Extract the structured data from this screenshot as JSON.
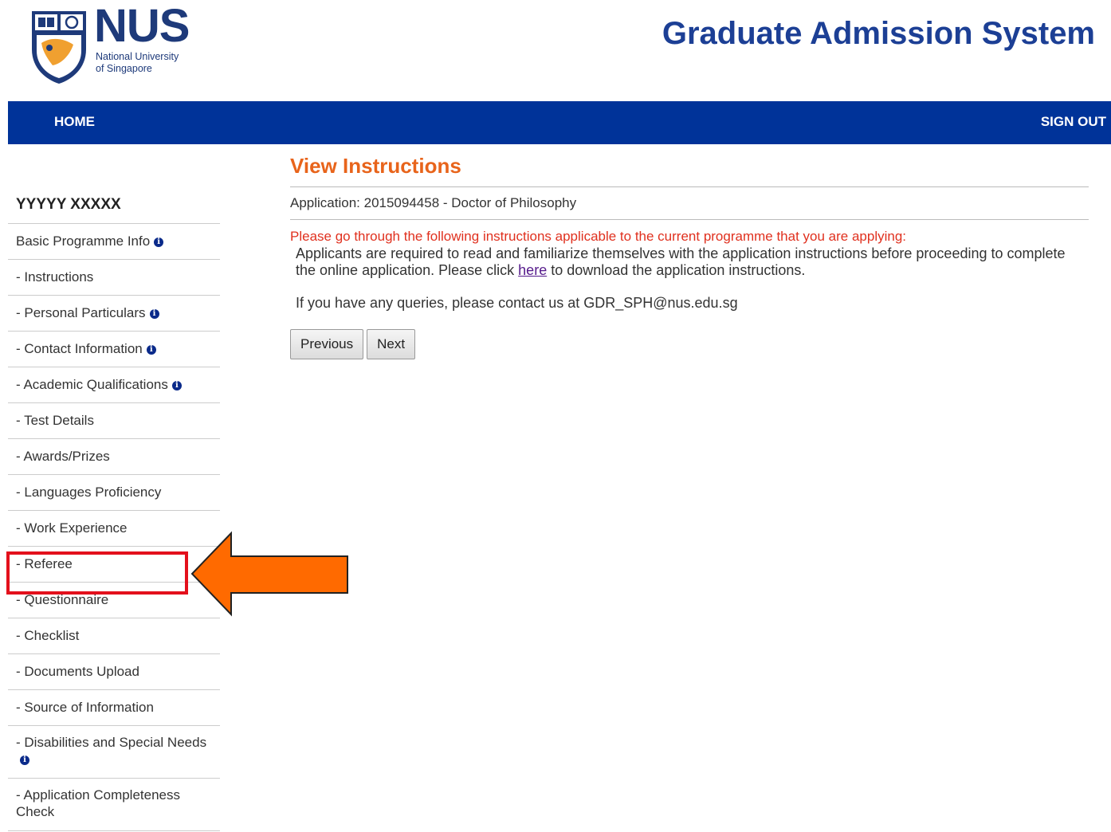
{
  "header": {
    "logo_text": "NUS",
    "logo_subtitle_line1": "National University",
    "logo_subtitle_line2": "of Singapore",
    "system_title": "Graduate Admission System"
  },
  "nav": {
    "home": "HOME",
    "sign_out": "SIGN OUT"
  },
  "sidebar": {
    "applicant_name": "YYYYY XXXXX",
    "items": [
      {
        "label": "Basic Programme Info",
        "info": true
      },
      {
        "label": "- Instructions",
        "info": false
      },
      {
        "label": "- Personal Particulars",
        "info": true
      },
      {
        "label": "- Contact Information",
        "info": true
      },
      {
        "label": "- Academic Qualifications",
        "info": true
      },
      {
        "label": "- Test Details",
        "info": false
      },
      {
        "label": "- Awards/Prizes",
        "info": false
      },
      {
        "label": "- Languages Proficiency",
        "info": false
      },
      {
        "label": "- Work Experience",
        "info": false
      },
      {
        "label": "- Referee",
        "info": false,
        "highlighted": true
      },
      {
        "label": "- Questionnaire",
        "info": false
      },
      {
        "label": "- Checklist",
        "info": false
      },
      {
        "label": "- Documents Upload",
        "info": false
      },
      {
        "label": "- Source of Information",
        "info": false
      },
      {
        "label": "- Disabilities and Special Needs",
        "info": true
      },
      {
        "label": "- Application Completeness Check",
        "info": false
      }
    ]
  },
  "main": {
    "title": "View Instructions",
    "application_line": "Application: 2015094458 - Doctor of Philosophy",
    "instruction_note": "Please go through the following instructions applicable to the current programme that you are applying:",
    "body_before_link": "Applicants are required to read and familiarize themselves with the application instructions before proceeding to complete the online application. Please click ",
    "link_text": "here",
    "body_after_link": " to download the application instructions.",
    "query_line": "If you have any queries, please contact us at GDR_SPH@nus.edu.sg",
    "previous_button": "Previous",
    "next_button": "Next"
  },
  "colors": {
    "nav_blue": "#003399",
    "title_orange": "#e8641b",
    "note_red": "#e0301e",
    "highlight_red": "#e3101c",
    "arrow_orange": "#ff6a00"
  },
  "icons": {
    "info": "info-icon",
    "arrow": "left-arrow-icon"
  }
}
